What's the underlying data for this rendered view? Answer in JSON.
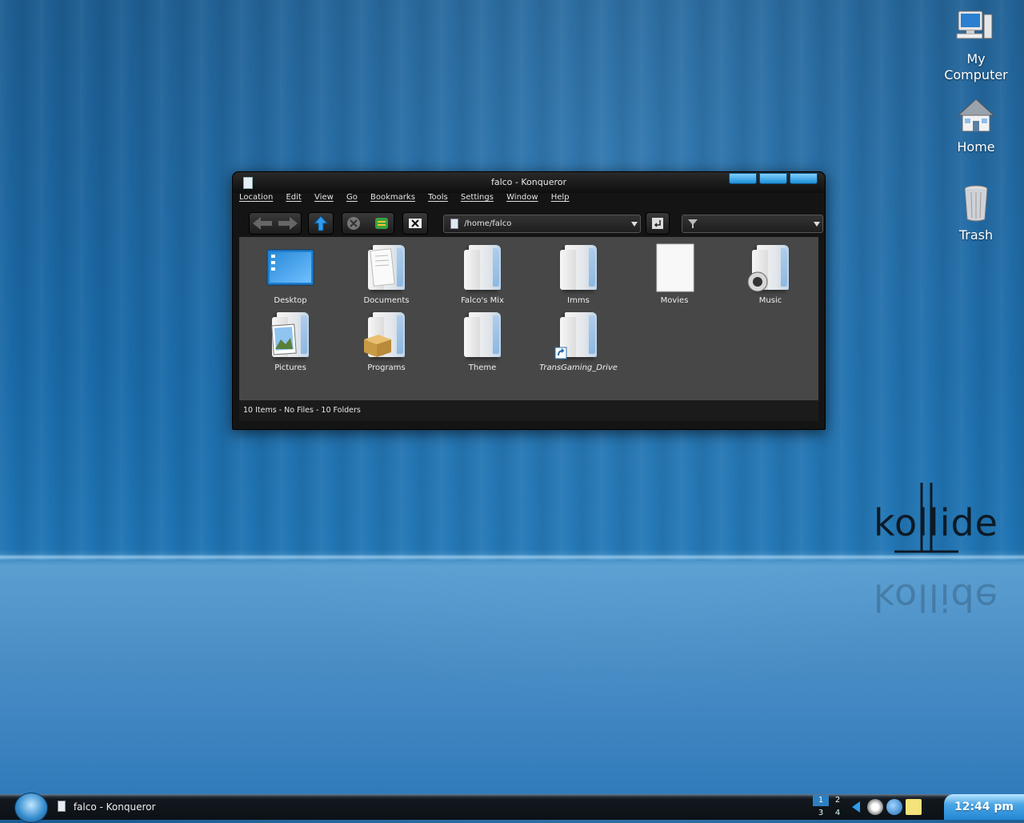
{
  "desktop": {
    "icons": [
      {
        "label_line1": "My",
        "label_line2": "Computer",
        "icon": "computer-icon"
      },
      {
        "label": "Home",
        "icon": "home-icon"
      },
      {
        "label": "Trash",
        "icon": "trash-icon"
      }
    ],
    "logo_text": "kollide"
  },
  "window": {
    "title": "falco - Konqueror",
    "menu": [
      "Location",
      "Edit",
      "View",
      "Go",
      "Bookmarks",
      "Tools",
      "Settings",
      "Window",
      "Help"
    ],
    "location": "/home/falco",
    "files": [
      {
        "label": "Desktop",
        "icon": "desktop-folder-icon"
      },
      {
        "label": "Documents",
        "icon": "documents-folder-icon"
      },
      {
        "label": "Falco's Mix",
        "icon": "folder-icon"
      },
      {
        "label": "Imms",
        "icon": "folder-icon"
      },
      {
        "label": "Movies",
        "icon": "movies-icon"
      },
      {
        "label": "Music",
        "icon": "music-folder-icon"
      },
      {
        "label": "Pictures",
        "icon": "pictures-folder-icon"
      },
      {
        "label": "Programs",
        "icon": "programs-folder-icon"
      },
      {
        "label": "Theme",
        "icon": "folder-icon"
      },
      {
        "label": "TransGaming_Drive",
        "icon": "folder-link-icon"
      }
    ],
    "status": "10 Items - No Files - 10 Folders"
  },
  "taskbar": {
    "task_label": "falco - Konqueror",
    "pager": [
      "1",
      "2",
      "3",
      "4"
    ],
    "clock": "12:44 pm"
  }
}
